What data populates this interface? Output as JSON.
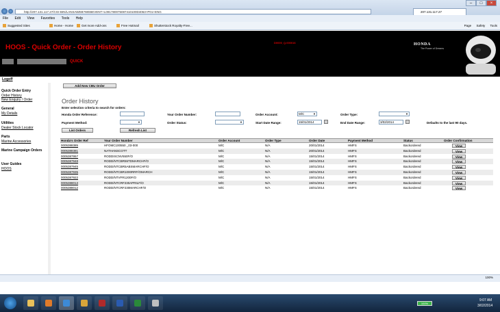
{
  "browser": {
    "address": "http://207.131.117.27/CGI-BIN/LANSAWEB?WEBEVENT+L091780075087410100D4063+P01+ENG",
    "tab_title": "207.131.117.27",
    "menu": [
      "File",
      "Edit",
      "View",
      "Favorites",
      "Tools",
      "Help"
    ],
    "favorites": [
      "Suggested Sites",
      "Home - Home",
      "Get more Add-ons",
      "Free Hotmail",
      "Shutterstock Royalty-Free..."
    ],
    "commands": [
      "Page",
      "Safety",
      "Tools"
    ],
    "zoom": "100%"
  },
  "header": {
    "title": "HOOS  - Quick Order - Order History",
    "user_code": "D0000_Q.000016",
    "quick": "QUICK",
    "brand": "HONDA",
    "brand_tagline": "The Power of Dreams"
  },
  "sidebar": {
    "logoff": "Logoff",
    "sections": [
      {
        "heading": "Quick Order Entry",
        "links": [
          "Order History",
          "New Enquiry / Order"
        ]
      },
      {
        "heading": "General",
        "links": [
          "My Details"
        ]
      },
      {
        "heading": "Utilities",
        "links": [
          "Dealer Stock Locator"
        ]
      },
      {
        "heading": "Parts",
        "links": [
          "Marine Accessories"
        ]
      },
      {
        "heading": "Marine Campaign Orders",
        "links": []
      },
      {
        "heading": "User Guides",
        "links": [
          "HOOS"
        ]
      }
    ]
  },
  "main": {
    "add_button": "Add New CBU Order",
    "heading": "Order History",
    "instructions": "Enter selection criteria to search for orders:",
    "filters": {
      "honda_ref_label": "Honda Order Reference:",
      "your_order_label": "Your Order Number:",
      "order_account_label": "Order Account:",
      "order_account_value": "M/C",
      "order_type_label": "Order Type:",
      "payment_method_label": "Payment Method:",
      "order_status_label": "Order Status:",
      "start_date_label": "Start Date Range:",
      "start_date_value": "15/01/2014",
      "end_date_label": "End Date Range:",
      "end_date_value": "3/02/2014",
      "defaults_note": "Defaults to the last 90 days."
    },
    "list_button": "List Orders",
    "refresh_button": "Refresh List",
    "table": {
      "columns": [
        "Honda's Order Ref",
        "Your Order Number",
        "Order Account",
        "Order Type",
        "Order Date",
        "Payment Method",
        "Status",
        "Order Confirmation"
      ],
      "view_label": "View",
      "rows": [
        [
          "0005388385",
          "HFOMC100550 _03-000",
          "M/C",
          "N/A",
          "20/01/2014",
          "HMFS",
          "Backordered"
        ],
        [
          "0005388381",
          "NATHANSCOTT",
          "M/C",
          "N/A",
          "20/01/2014",
          "HMFS",
          "Backordered"
        ],
        [
          "0005387957",
          "RODDISCNV550F/O",
          "M/C",
          "N/A",
          "15/01/2014",
          "HMFS",
          "Backordered"
        ],
        [
          "0005387948",
          "RODD/NTCBR55TDMARCHF/O",
          "M/C",
          "N/A",
          "15/01/2014",
          "HMFS",
          "Backordered"
        ],
        [
          "0005387945",
          "RODD/NTCBR5ABSMARCHF/O",
          "M/C",
          "N/A",
          "15/01/2014",
          "HMFS",
          "Backordered"
        ],
        [
          "0005387935",
          "RODD/NTCBR1000RRF/OMARCH",
          "M/C",
          "N/A",
          "15/01/2014",
          "HMFS",
          "Backordered"
        ],
        [
          "0005387922",
          "RODD/NTVFR1200F/O",
          "M/C",
          "N/A",
          "15/01/2014",
          "HMFS",
          "Backordered"
        ],
        [
          "0005388013",
          "RODD/NTCRF230APRILF/O",
          "M/C",
          "N/A",
          "15/01/2014",
          "HMFS",
          "Backordered"
        ],
        [
          "0005388012",
          "RODD/NTCRF230MARCHF/O",
          "M/C",
          "N/A",
          "15/01/2014",
          "HMFS",
          "Backordered"
        ]
      ]
    }
  },
  "taskbar": {
    "battery": "100%",
    "time": "9:07 AM",
    "date": "3/02/2014"
  }
}
